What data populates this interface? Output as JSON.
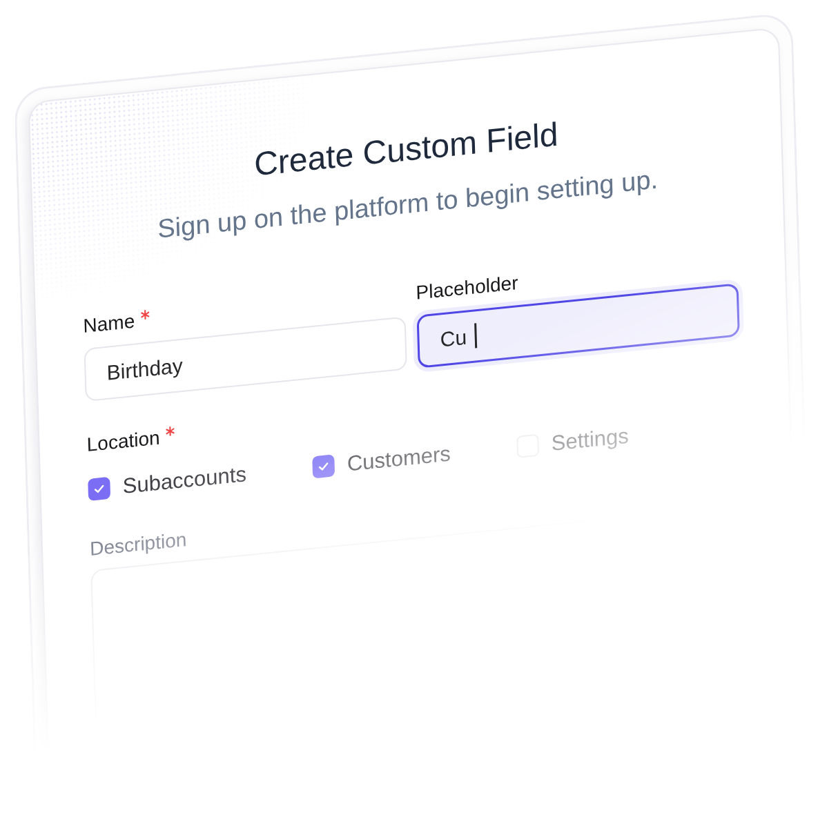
{
  "header": {
    "title": "Create Custom Field",
    "subtitle": "Sign up on the platform to begin setting up."
  },
  "fields": [
    {
      "label": "Name",
      "required": true,
      "value": "Birthday",
      "focused": false
    },
    {
      "label": "Placeholder",
      "required": false,
      "value": "Cu",
      "focused": true
    }
  ],
  "location": {
    "label": "Location",
    "required": true,
    "options": [
      {
        "label": "Subaccounts",
        "checked": true
      },
      {
        "label": "Customers",
        "checked": true
      },
      {
        "label": "Settings",
        "checked": false
      }
    ]
  },
  "description": {
    "label": "Description",
    "required": false
  }
}
